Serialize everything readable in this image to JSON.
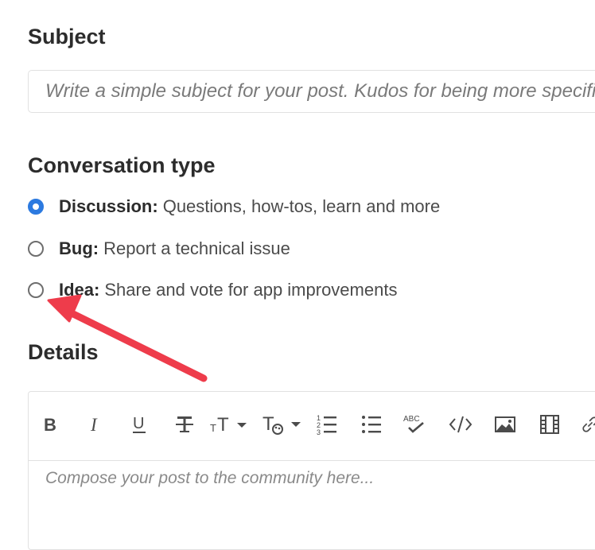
{
  "subject": {
    "title": "Subject",
    "placeholder": "Write a simple subject for your post. Kudos for being more specific.",
    "value": ""
  },
  "conversation_type": {
    "title": "Conversation type",
    "options": [
      {
        "label": "Discussion:",
        "description": "Questions, how-tos, learn and more",
        "checked": true
      },
      {
        "label": "Bug:",
        "description": "Report a technical issue",
        "checked": false
      },
      {
        "label": "Idea:",
        "description": "Share and vote for app improvements",
        "checked": false
      }
    ]
  },
  "details": {
    "title": "Details",
    "placeholder": "Compose your post to the community here...",
    "toolbar_icons": [
      "bold-icon",
      "italic-icon",
      "underline-icon",
      "strikethrough-icon",
      "font-size-icon",
      "text-color-icon",
      "numbered-list-icon",
      "bulleted-list-icon",
      "spell-check-icon",
      "code-icon",
      "image-icon",
      "video-icon",
      "link-icon"
    ]
  },
  "colors": {
    "accent": "#2c7ae0",
    "annotation_arrow": "#ee3c4b"
  }
}
